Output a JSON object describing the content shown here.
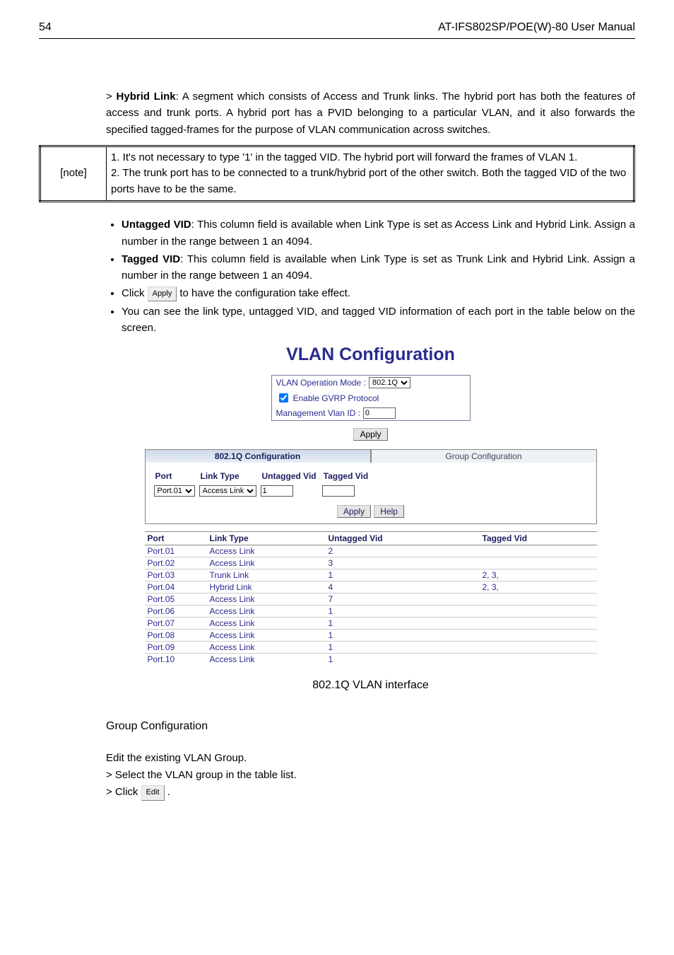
{
  "header": {
    "page_number": "54",
    "manual_title": "AT-IFS802SP/POE(W)-80 User Manual"
  },
  "hybrid_link": {
    "prefix": ">",
    "label": "Hybrid Link",
    "text": ": A segment which consists of Access and Trunk links. The hybrid port has both the features of access and trunk ports. A hybrid port has a PVID belonging to a particular VLAN, and it also forwards the specified tagged-frames for the purpose of VLAN communication across switches."
  },
  "note": {
    "label": "[note]",
    "line1": "1. It's not necessary to type '1' in the tagged VID. The hybrid port will forward the frames of VLAN 1.",
    "line2": "2. The trunk port has to be connected to a trunk/hybrid port of the other switch. Both the tagged VID of the two ports have to be the same."
  },
  "bullets": {
    "b1_label": "Untagged VID",
    "b1_text": ": This column field is available when Link Type is set as Access Link and Hybrid Link. Assign a number in the range between 1 an 4094.",
    "b2_label": "Tagged VID",
    "b2_text": ": This column field is available when Link Type is set as Trunk Link and Hybrid Link. Assign a number in the range between 1 an 4094.",
    "b3_pre": "Click ",
    "b3_btn": "Apply",
    "b3_post": " to have the configuration take effect.",
    "b4_text": "You can see the link type, untagged VID, and tagged VID information of each port in the table below on the screen."
  },
  "screenshot": {
    "title": "VLAN Configuration",
    "op_mode_label": "VLAN Operation Mode :",
    "op_mode_value": "802.1Q",
    "gvrp_label": "Enable GVRP Protocol",
    "mgmt_vlan_label": "Management Vlan ID :",
    "mgmt_vlan_value": "0",
    "apply_btn": "Apply",
    "help_btn": "Help",
    "tab_active": "802.1Q Configuration",
    "tab_inactive": "Group Configuration",
    "col_port": "Port",
    "col_linktype": "Link Type",
    "col_untagged": "Untagged Vid",
    "col_tagged": "Tagged Vid",
    "sel_port": "Port.01",
    "sel_link": "Access Link",
    "sel_untagged": "1",
    "sel_tagged": "",
    "rows": [
      {
        "port": "Port.01",
        "link": "Access Link",
        "untag": "2",
        "tag": ""
      },
      {
        "port": "Port.02",
        "link": "Access Link",
        "untag": "3",
        "tag": ""
      },
      {
        "port": "Port.03",
        "link": "Trunk Link",
        "untag": "1",
        "tag": "2, 3,"
      },
      {
        "port": "Port.04",
        "link": "Hybrid Link",
        "untag": "4",
        "tag": "2, 3,"
      },
      {
        "port": "Port.05",
        "link": "Access Link",
        "untag": "7",
        "tag": ""
      },
      {
        "port": "Port.06",
        "link": "Access Link",
        "untag": "1",
        "tag": ""
      },
      {
        "port": "Port.07",
        "link": "Access Link",
        "untag": "1",
        "tag": ""
      },
      {
        "port": "Port.08",
        "link": "Access Link",
        "untag": "1",
        "tag": ""
      },
      {
        "port": "Port.09",
        "link": "Access Link",
        "untag": "1",
        "tag": ""
      },
      {
        "port": "Port.10",
        "link": "Access Link",
        "untag": "1",
        "tag": ""
      }
    ]
  },
  "caption": "802.1Q VLAN interface",
  "group_config": {
    "heading": "Group Configuration",
    "line1": "Edit the existing VLAN Group.",
    "line2": "> Select the VLAN group in the table list.",
    "line3_pre": "> Click ",
    "line3_btn": "Edit",
    "line3_post": " ."
  }
}
